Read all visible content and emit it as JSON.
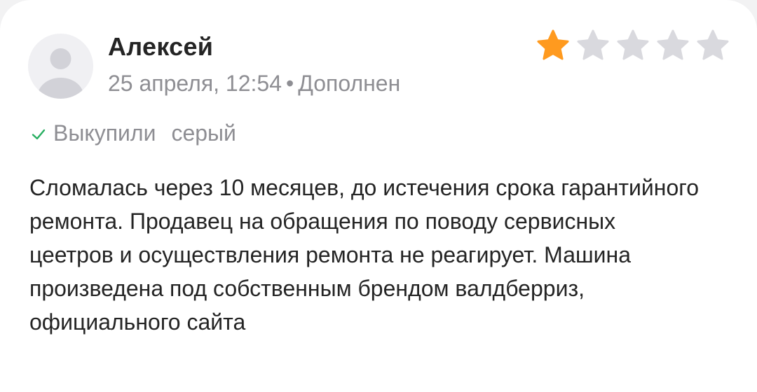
{
  "review": {
    "author": "Алексей",
    "date": "25 апреля, 12:54",
    "separator": "•",
    "edited_label": "Дополнен",
    "rating": 1,
    "rating_max": 5,
    "purchase_status": "Выкупили",
    "color_variant": "серый",
    "text": "Сломалась через 10 месяцев, до истечения срока гарантийного ремонта. Продавец на обращения по поводу сервисных цеетров и осуществления ремонта не реагирует. Машина произведена под собственным брендом валдберриз, официального сайта"
  },
  "colors": {
    "star_filled": "#ff9a1f",
    "star_empty": "#d9d9de",
    "check_green": "#27ae60",
    "muted_text": "#8e8e93",
    "primary_text": "#242424"
  },
  "icons": {
    "avatar": "user-placeholder-icon",
    "star": "star-icon",
    "check": "check-icon"
  }
}
